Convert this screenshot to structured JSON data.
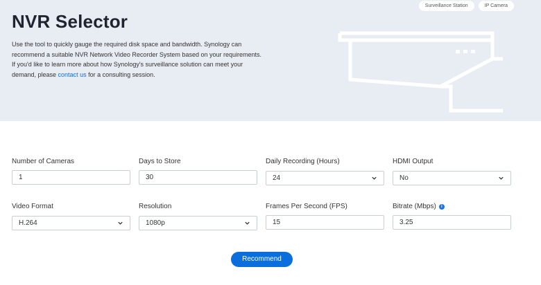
{
  "header": {
    "tags": [
      "Surveillance Station",
      "IP Camera"
    ],
    "title": "NVR Selector",
    "intro_before_link": "Use the tool to quickly gauge the required disk space and bandwidth. Synology can recommend a suitable NVR Network Video Recorder System based on your requirements. If you'd like to learn more about how Synology's surveillance solution can meet your demand, please ",
    "intro_link": "contact us",
    "intro_after_link": " for a consulting session."
  },
  "form": {
    "num_cameras": {
      "label": "Number of Cameras",
      "value": "1"
    },
    "days_to_store": {
      "label": "Days to Store",
      "value": "30"
    },
    "daily_recording": {
      "label": "Daily Recording (Hours)",
      "value": "24"
    },
    "hdmi_output": {
      "label": "HDMI Output",
      "value": "No"
    },
    "video_format": {
      "label": "Video Format",
      "value": "H.264"
    },
    "resolution": {
      "label": "Resolution",
      "value": "1080p"
    },
    "fps": {
      "label": "Frames Per Second (FPS)",
      "value": "15"
    },
    "bitrate": {
      "label": "Bitrate (Mbps)",
      "value": "3.25"
    }
  },
  "actions": {
    "recommend": "Recommend"
  },
  "colors": {
    "accent": "#0a6fdc",
    "hero_bg": "#e8ecf3"
  }
}
